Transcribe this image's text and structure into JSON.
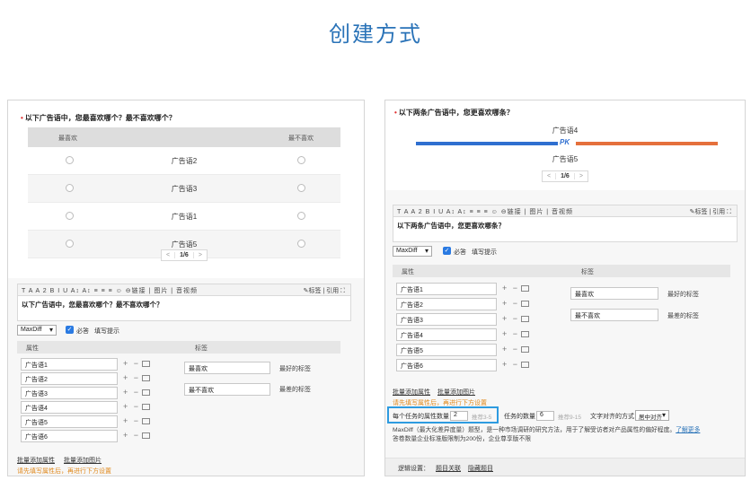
{
  "page_title": "创建方式",
  "left": {
    "question": "以下广告语中，您最喜欢哪个？最不喜欢哪个？",
    "col_best": "最喜欢",
    "col_worst": "最不喜欢",
    "rows": [
      "广告语2",
      "广告语3",
      "广告语1",
      "广告语5"
    ],
    "pager": {
      "prev": "<",
      "page": "1/6",
      "next": ">"
    },
    "toolbar_left": "T A A 2 B I U A↕ A↕ ≡ ≡ ≡ ☺ ⊖链接 | 图片 | 音视频",
    "toolbar_right": "✎标签 | 引用 ⛶",
    "editor_text": "以下广告语中，您最喜欢哪个？最不喜欢哪个？",
    "type_select": "MaxDiff",
    "required_label": "必答",
    "fill_hint": "填写提示",
    "attr_header": "属性",
    "tag_header": "标签",
    "attrs": [
      "广告语1",
      "广告语2",
      "广告语3",
      "广告语4",
      "广告语5",
      "广告语6"
    ],
    "ops": "+ −",
    "tag_best": "最喜欢",
    "tag_best_note": "最好的标签",
    "tag_worst": "最不喜欢",
    "tag_worst_note": "最差的标签",
    "batch_attr": "批量添加属性",
    "batch_img": "批量添加图片",
    "warn": "请先填写属性后，再进行下方设置"
  },
  "right": {
    "question": "以下两条广告语中，您更喜欢哪条？",
    "top_item": "广告语4",
    "pk": "PK",
    "bottom_item": "广告语5",
    "pager": {
      "prev": "<",
      "page": "1/6",
      "next": ">"
    },
    "toolbar_left": "T A A 2 B I U A↕ A↕ ≡ ≡ ≡ ☺ ⊖链接 | 图片 | 音视频",
    "toolbar_right": "✎标签 | 引用 ⛶",
    "editor_text": "以下两条广告语中，您更喜欢哪条？",
    "type_select": "MaxDiff",
    "required_label": "必答",
    "fill_hint": "填写提示",
    "attr_header": "属性",
    "tag_header": "标签",
    "attrs": [
      "广告语1",
      "广告语2",
      "广告语3",
      "广告语4",
      "广告语5",
      "广告语6"
    ],
    "ops": "+ −",
    "tag_best": "最喜欢",
    "tag_best_note": "最好的标签",
    "tag_worst": "最不喜欢",
    "tag_worst_note": "最差的标签",
    "batch_attr": "批量添加属性",
    "batch_img": "批量添加图片",
    "warn": "请先填写属性后，再进行下方设置",
    "attrs_per_task_label": "每个任务的属性数量",
    "attrs_per_task_value": "2",
    "attrs_per_task_hint": "推荐3-5",
    "task_count_label": "任务的数量",
    "task_count_value": "6",
    "task_count_hint": "推荐9-15",
    "align_label": "文字对齐的方式",
    "align_value": "居中对齐",
    "desc_line1": "MaxDiff（最大化差异度量）题型，是一种市场调研的研究方法，用于了解受访者对产品属性的偏好程度。",
    "desc_link": "了解更多",
    "desc_line2": "答卷数量企业标准版限制为200份，企业尊享版不限",
    "logic_label": "逻辑设置：",
    "logic_link1": "题目关联",
    "logic_link2": "隐藏题目"
  },
  "colors": {
    "accent": "#2a73b8",
    "pk_blue": "#2f6fd0",
    "pk_orange": "#e5703c",
    "highlight": "#2e9be0",
    "warn": "#e08a1e"
  }
}
